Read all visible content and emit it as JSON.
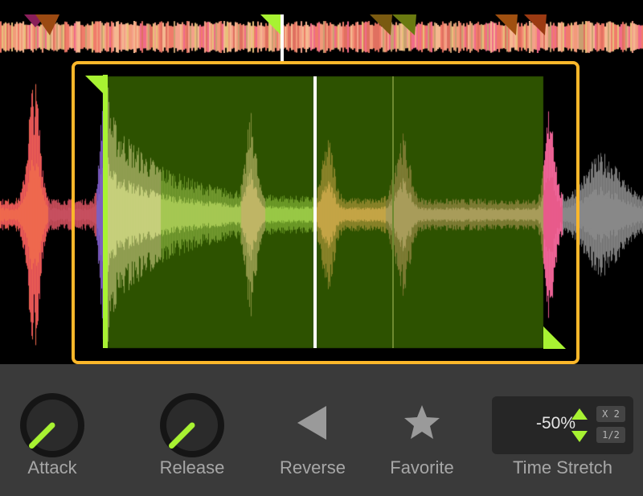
{
  "colors": {
    "accent": "#a8f232",
    "selection_border": "#fbb72a",
    "selection_fill": "#2d5200",
    "panel_bg": "#3a3a3a",
    "label": "#a7a7a7"
  },
  "controls": {
    "attack": {
      "label": "Attack",
      "level": 0.25
    },
    "release": {
      "label": "Release",
      "level": 0.25
    },
    "reverse": {
      "label": "Reverse"
    },
    "favorite": {
      "label": "Favorite"
    },
    "time_stretch": {
      "label": "Time Stretch",
      "value": "-50%",
      "double_label": "X 2",
      "half_label": "1/2"
    }
  }
}
